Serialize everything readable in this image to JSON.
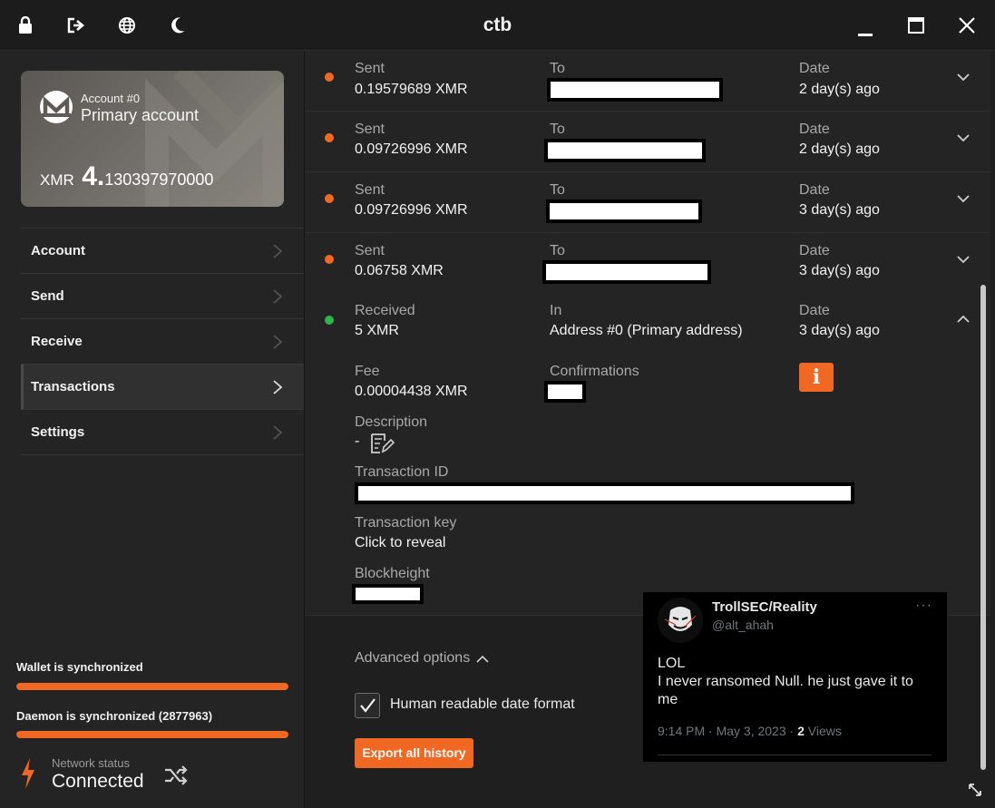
{
  "window": {
    "title": "ctb"
  },
  "titlebar_icons": [
    "lock-icon",
    "logout-icon",
    "globe-icon",
    "moon-icon"
  ],
  "account": {
    "number_label": "Account #0",
    "name": "Primary account",
    "currency": "XMR",
    "balance_big": "4.",
    "balance_rest": "130397970000"
  },
  "nav": {
    "items": [
      {
        "label": "Account"
      },
      {
        "label": "Send"
      },
      {
        "label": "Receive"
      },
      {
        "label": "Transactions"
      },
      {
        "label": "Settings"
      }
    ]
  },
  "status": {
    "wallet_sync": "Wallet is synchronized",
    "wallet_progress": 1.0,
    "daemon_sync": "Daemon is synchronized (2877963)",
    "daemon_progress": 1.0,
    "network_label": "Network status",
    "network_value": "Connected"
  },
  "transactions": [
    {
      "type": "Sent",
      "amount": "0.19579689 XMR",
      "dir_label": "To",
      "date_label": "Date",
      "date": "2 day(s) ago"
    },
    {
      "type": "Sent",
      "amount": "0.09726996 XMR",
      "dir_label": "To",
      "date_label": "Date",
      "date": "2 day(s) ago"
    },
    {
      "type": "Sent",
      "amount": "0.09726996 XMR",
      "dir_label": "To",
      "date_label": "Date",
      "date": "3 day(s) ago"
    },
    {
      "type": "Sent",
      "amount": "0.06758 XMR",
      "dir_label": "To",
      "date_label": "Date",
      "date": "3 day(s) ago"
    }
  ],
  "expanded_tx": {
    "type": "Received",
    "amount": "5 XMR",
    "dir_label": "In",
    "address": "Address #0 (Primary address)",
    "date_label": "Date",
    "date": "3 day(s) ago",
    "fee_label": "Fee",
    "fee": "0.00004438 XMR",
    "confirmations_label": "Confirmations",
    "description_label": "Description",
    "description": "-",
    "txid_label": "Transaction ID",
    "txkey_label": "Transaction key",
    "txkey_value": "Click to reveal",
    "blockheight_label": "Blockheight"
  },
  "options": {
    "advanced_label": "Advanced options",
    "human_date_label": "Human readable date format",
    "export_label": "Export all history"
  },
  "tweet": {
    "name": "TrollSEC/Reality",
    "handle": "@alt_ahah",
    "more": "···",
    "text_line1": "LOL",
    "text_line2": "I never ransomed Null. he just gave it to me",
    "time": "9:14 PM · May 3, 2023 · ",
    "views_count": "2",
    "views_label": " Views"
  },
  "colors": {
    "accent": "#f16822",
    "sent_dot": "#f16822",
    "received_dot": "#2fb44c"
  }
}
